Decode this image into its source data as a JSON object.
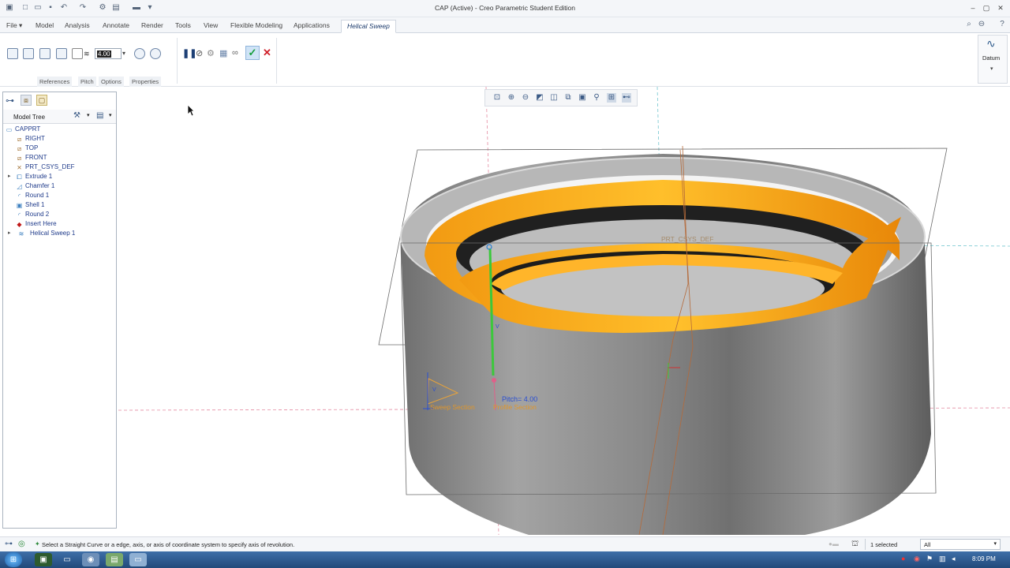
{
  "window": {
    "title": "CAP (Active) - Creo Parametric Student Edition"
  },
  "tabs": [
    {
      "label": "File ▾"
    },
    {
      "label": "Model"
    },
    {
      "label": "Analysis"
    },
    {
      "label": "Annotate"
    },
    {
      "label": "Render"
    },
    {
      "label": "Tools"
    },
    {
      "label": "View"
    },
    {
      "label": "Flexible Modeling"
    },
    {
      "label": "Applications"
    },
    {
      "label": "Helical Sweep"
    }
  ],
  "ribbon": {
    "pitch_value": "4.00",
    "subtabs": [
      "References",
      "Pitch",
      "Options",
      "Properties"
    ],
    "datum_label": "Datum"
  },
  "model_tree": {
    "header": "Model Tree",
    "items": [
      {
        "label": "CAPPRT",
        "icon": "part-icon"
      },
      {
        "label": "RIGHT",
        "icon": "datum-plane-icon"
      },
      {
        "label": "TOP",
        "icon": "datum-plane-icon"
      },
      {
        "label": "FRONT",
        "icon": "datum-plane-icon"
      },
      {
        "label": "PRT_CSYS_DEF",
        "icon": "csys-icon"
      },
      {
        "label": "Extrude 1",
        "icon": "extrude-icon"
      },
      {
        "label": "Chamfer 1",
        "icon": "chamfer-icon"
      },
      {
        "label": "Round 1",
        "icon": "round-icon"
      },
      {
        "label": "Shell 1",
        "icon": "shell-icon"
      },
      {
        "label": "Round 2",
        "icon": "round-icon"
      },
      {
        "label": "Insert Here",
        "icon": "insert-arrow-icon"
      },
      {
        "label": "Helical Sweep 1",
        "icon": "helical-sweep-icon"
      }
    ]
  },
  "graphics": {
    "csys_label": "PRT_CSYS_DEF",
    "pitch_label": "Pitch= 4.00",
    "sweep_section_label": "Sweep Section",
    "profile_section_label": "Profile Section",
    "axis_label": "V",
    "colors": {
      "body": "#a6a6a6",
      "sweep": "#f7a01c",
      "plane": "#6b6b6b"
    }
  },
  "status": {
    "message": "Select a  Straight Curve or a edge, axis, or axis of coordinate system to specify axis of revolution.",
    "selected": "1 selected",
    "filter": "All"
  },
  "taskbar": {
    "clock": "8:09 PM"
  }
}
